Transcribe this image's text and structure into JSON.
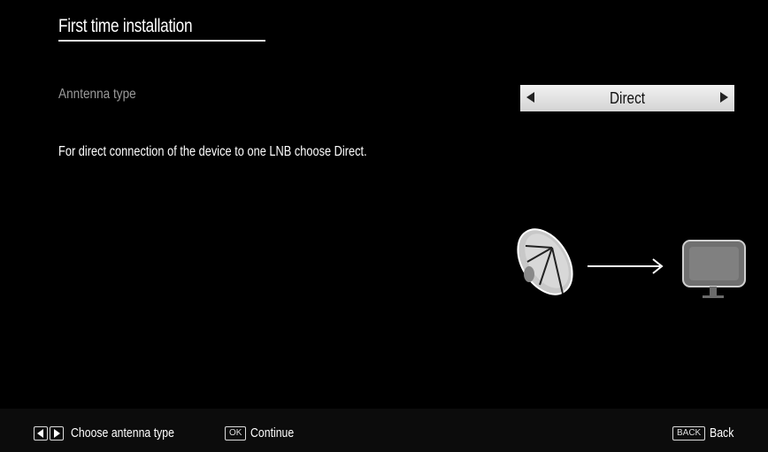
{
  "header": {
    "title": "First time installation"
  },
  "setting": {
    "label": "Anntenna type",
    "value": "Direct"
  },
  "description": "For direct connection of the device to one LNB choose Direct.",
  "footer": {
    "choose_label": "Choose antenna type",
    "ok_key": "OK",
    "continue_label": "Continue",
    "back_key": "BACK",
    "back_label": "Back"
  },
  "colors": {
    "background": "#000000",
    "selector_bg": "#e0e0e0",
    "label_gray": "#9a9a9a",
    "tv_gray": "#707070"
  },
  "icons": [
    "left-arrow-icon",
    "right-arrow-icon",
    "satellite-dish-icon",
    "arrow-right-icon",
    "tv-icon",
    "ok-key-icon",
    "back-key-icon"
  ]
}
